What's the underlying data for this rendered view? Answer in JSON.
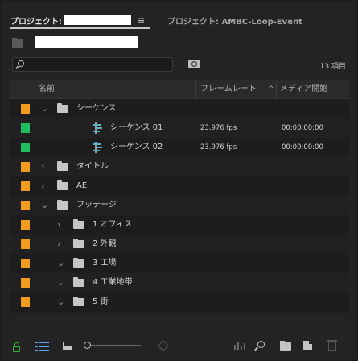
{
  "tabs": {
    "active_label": "プロジェクト:",
    "menu_icon": "hamburger-icon",
    "inactive_label": "プロジェクト: AMBC-Loop-Event"
  },
  "search": {
    "placeholder": "",
    "item_count": "13 項目"
  },
  "columns": {
    "name": "名前",
    "frame_rate": "フレームレート",
    "sort_indicator": "^",
    "media_start": "メディア開始"
  },
  "colors": {
    "label_orange": "#f29c1f",
    "label_green": "#1fbf5f",
    "accent_blue": "#5aa9ff",
    "lock_green": "#3fae3f"
  },
  "rows": [
    {
      "label_color": "#f29c1f",
      "twisty": "⌄",
      "type": "folder",
      "name": "シーケンス",
      "fps": "",
      "start": ""
    },
    {
      "label_color": "#1fbf5f",
      "twisty": "",
      "type": "sequence",
      "name": "シーケンス 01",
      "fps": "23.976 fps",
      "start": "00:00:00:00"
    },
    {
      "label_color": "#1fbf5f",
      "twisty": "",
      "type": "sequence",
      "name": "シーケンス 02",
      "fps": "23.976 fps",
      "start": "00:00:00:00"
    },
    {
      "label_color": "#f29c1f",
      "twisty": "›",
      "type": "folder",
      "name": "タイトル",
      "fps": "",
      "start": ""
    },
    {
      "label_color": "#f29c1f",
      "twisty": "›",
      "type": "folder",
      "name": "AE",
      "fps": "",
      "start": ""
    },
    {
      "label_color": "#f29c1f",
      "twisty": "⌄",
      "type": "folder",
      "name": "フッテージ",
      "fps": "",
      "start": ""
    },
    {
      "label_color": "#f29c1f",
      "twisty": "›",
      "type": "folder",
      "name": "1 オフィス",
      "fps": "",
      "start": ""
    },
    {
      "label_color": "#f29c1f",
      "twisty": "›",
      "type": "folder",
      "name": "2 外観",
      "fps": "",
      "start": ""
    },
    {
      "label_color": "#f29c1f",
      "twisty": "⌄",
      "type": "folder",
      "name": "3 工場",
      "fps": "",
      "start": ""
    },
    {
      "label_color": "#f29c1f",
      "twisty": "⌄",
      "type": "folder",
      "name": "4 工業地帯",
      "fps": "",
      "start": ""
    },
    {
      "label_color": "#f29c1f",
      "twisty": "⌄",
      "type": "folder",
      "name": "5 街",
      "fps": "",
      "start": ""
    }
  ],
  "toolbar_icons": [
    "lock-icon",
    "list-view-icon",
    "icon-view-icon",
    "zoom-slider",
    "sort-icon",
    "automate-to-sequence-icon",
    "find-icon",
    "new-bin-icon",
    "new-item-icon",
    "trash-icon"
  ]
}
